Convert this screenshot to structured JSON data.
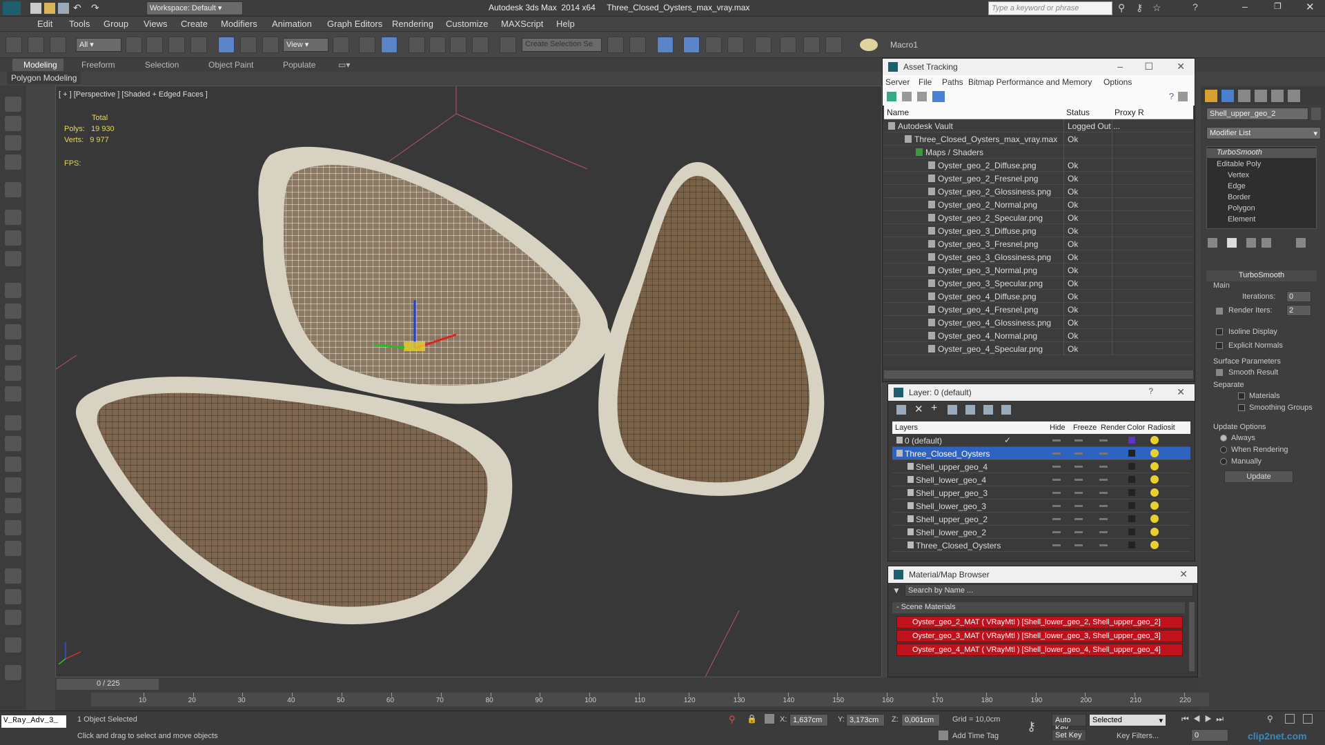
{
  "app": {
    "workspace": "Workspace: Default",
    "title": "Autodesk 3ds Max  2014 x64     Three_Closed_Oysters_max_vray.max",
    "search_placeholder": "Type a keyword or phrase"
  },
  "menu": [
    "Edit",
    "Tools",
    "Group",
    "Views",
    "Create",
    "Modifiers",
    "Animation",
    "Graph Editors",
    "Rendering",
    "Customize",
    "MAXScript",
    "Help"
  ],
  "toolbar": {
    "selection_filter": "All",
    "ref_coord": "View",
    "selection_set_placeholder": "Create Selection Se",
    "macro": "Macro1"
  },
  "ribbon": {
    "tabs": [
      "Modeling",
      "Freeform",
      "Selection",
      "Object Paint",
      "Populate"
    ],
    "panel": "Polygon Modeling"
  },
  "viewport": {
    "label": "[ + ] [Perspective ] [Shaded + Edged Faces ]",
    "stats": {
      "total": "Total",
      "polys_label": "Polys:",
      "polys": "19 930",
      "verts_label": "Verts:",
      "verts": "9 977",
      "fps_label": "FPS:"
    }
  },
  "asset_tracking": {
    "title": "Asset Tracking",
    "menu": [
      "Server",
      "File",
      "Paths",
      "Bitmap Performance and Memory",
      "Options"
    ],
    "columns": [
      "Name",
      "Status",
      "Proxy R"
    ],
    "rows": [
      {
        "name": "Autodesk Vault",
        "status": "Logged Out ..."
      },
      {
        "name": "Three_Closed_Oysters_max_vray.max",
        "status": "Ok"
      },
      {
        "name": "Maps / Shaders",
        "status": ""
      },
      {
        "name": "Oyster_geo_2_Diffuse.png",
        "status": "Ok"
      },
      {
        "name": "Oyster_geo_2_Fresnel.png",
        "status": "Ok"
      },
      {
        "name": "Oyster_geo_2_Glossiness.png",
        "status": "Ok"
      },
      {
        "name": "Oyster_geo_2_Normal.png",
        "status": "Ok"
      },
      {
        "name": "Oyster_geo_2_Specular.png",
        "status": "Ok"
      },
      {
        "name": "Oyster_geo_3_Diffuse.png",
        "status": "Ok"
      },
      {
        "name": "Oyster_geo_3_Fresnel.png",
        "status": "Ok"
      },
      {
        "name": "Oyster_geo_3_Glossiness.png",
        "status": "Ok"
      },
      {
        "name": "Oyster_geo_3_Normal.png",
        "status": "Ok"
      },
      {
        "name": "Oyster_geo_3_Specular.png",
        "status": "Ok"
      },
      {
        "name": "Oyster_geo_4_Diffuse.png",
        "status": "Ok"
      },
      {
        "name": "Oyster_geo_4_Fresnel.png",
        "status": "Ok"
      },
      {
        "name": "Oyster_geo_4_Glossiness.png",
        "status": "Ok"
      },
      {
        "name": "Oyster_geo_4_Normal.png",
        "status": "Ok"
      },
      {
        "name": "Oyster_geo_4_Specular.png",
        "status": "Ok"
      }
    ]
  },
  "layers": {
    "title": "Layer: 0 (default)",
    "columns": [
      "Layers",
      "Hide",
      "Freeze",
      "Render",
      "Color",
      "Radiosit"
    ],
    "rows": [
      "0 (default)",
      "Three_Closed_Oysters",
      "Shell_upper_geo_4",
      "Shell_lower_geo_4",
      "Shell_upper_geo_3",
      "Shell_lower_geo_3",
      "Shell_upper_geo_2",
      "Shell_lower_geo_2",
      "Three_Closed_Oysters"
    ]
  },
  "material_browser": {
    "title": "Material/Map Browser",
    "search_placeholder": "Search by Name ...",
    "section": "- Scene Materials",
    "materials": [
      "Oyster_geo_2_MAT  ( VRayMtl )  [Shell_lower_geo_2, Shell_upper_geo_2]",
      "Oyster_geo_3_MAT  ( VRayMtl )  [Shell_lower_geo_3, Shell_upper_geo_3]",
      "Oyster_geo_4_MAT  ( VRayMtl )  [Shell_lower_geo_4, Shell_upper_geo_4]"
    ]
  },
  "command_panel": {
    "object_name": "Shell_upper_geo_2",
    "modifier_list": "Modifier List",
    "stack": [
      "TurboSmooth",
      "Editable Poly",
      "Vertex",
      "Edge",
      "Border",
      "Polygon",
      "Element"
    ],
    "turbosmooth": {
      "title": "TurboSmooth",
      "main": "Main",
      "iterations_label": "Iterations:",
      "iterations": "0",
      "render_iters_label": "Render Iters:",
      "render_iters": "2",
      "isoline": "Isoline Display",
      "explicit": "Explicit Normals",
      "surface": "Surface Parameters",
      "smooth_result": "Smooth Result",
      "separate": "Separate",
      "materials": "Materials",
      "smoothing_groups": "Smoothing Groups",
      "update_options": "Update Options",
      "always": "Always",
      "when_rendering": "When Rendering",
      "manually": "Manually",
      "update_button": "Update"
    }
  },
  "timeline": {
    "frame": "0 / 225",
    "ticks": [
      "10",
      "20",
      "30",
      "40",
      "50",
      "60",
      "70",
      "80",
      "90",
      "100",
      "110",
      "120",
      "130",
      "140",
      "150",
      "160",
      "170",
      "180",
      "190",
      "200",
      "210",
      "220"
    ]
  },
  "status": {
    "script": "V_Ray_Adv_3_",
    "selected": "1 Object Selected",
    "prompt": "Click and drag to select and move objects",
    "x_label": "X:",
    "x": "1,637cm",
    "y_label": "Y:",
    "y": "3,173cm",
    "z_label": "Z:",
    "z": "0,001cm",
    "grid": "Grid = 10,0cm",
    "autokey": "Auto Key",
    "setkey": "Set Key",
    "selected_set": "Selected",
    "key_filters": "Key Filters...",
    "add_time_tag": "Add Time Tag",
    "frame_field": "0",
    "watermark": "clip2net.com"
  }
}
